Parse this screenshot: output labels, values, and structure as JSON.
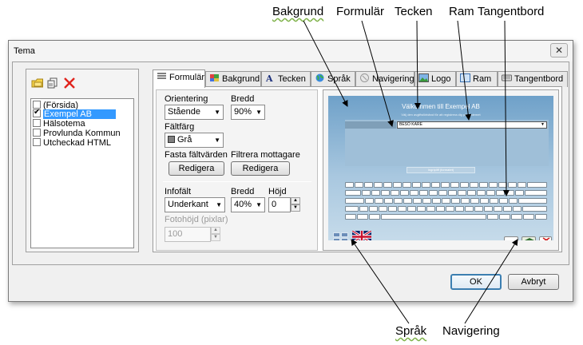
{
  "callouts": {
    "bakgrund": "Bakgrund",
    "formular": "Formulär",
    "tecken": "Tecken",
    "ram": "Ram",
    "tangentbord": "Tangentbord",
    "sprak": "Språk",
    "navigering": "Navigering"
  },
  "window": {
    "title": "Tema",
    "close": "✕"
  },
  "toolbar": {
    "icons": [
      "folder-icon",
      "copy-icon",
      "delete-icon"
    ]
  },
  "list": {
    "items": [
      {
        "label": "(Försida)",
        "checked": false,
        "selected": false
      },
      {
        "label": "Exempel AB",
        "checked": true,
        "selected": true
      },
      {
        "label": "Hälsotema",
        "checked": false,
        "selected": false
      },
      {
        "label": "Provlunda Kommun",
        "checked": false,
        "selected": false
      },
      {
        "label": "Utcheckad HTML",
        "checked": false,
        "selected": false
      }
    ]
  },
  "tabs": [
    {
      "label": "Formulär",
      "icon": "form-icon",
      "active": true
    },
    {
      "label": "Bakgrund",
      "icon": "background-icon"
    },
    {
      "label": "Tecken",
      "icon": "font-icon"
    },
    {
      "label": "Språk",
      "icon": "globe-icon"
    },
    {
      "label": "Navigering",
      "icon": "navigation-icon"
    },
    {
      "label": "Logo",
      "icon": "logo-icon"
    },
    {
      "label": "Ram",
      "icon": "frame-icon"
    },
    {
      "label": "Tangentbord",
      "icon": "keyboard-icon"
    }
  ],
  "form": {
    "orientering_label": "Orientering",
    "orientering_value": "Stående",
    "bredd_label": "Bredd",
    "bredd_value": "90%",
    "faltfarg_label": "Fältfärg",
    "faltfarg_value": "Grå",
    "faltfarg_swatch": "#808080",
    "fasta_label": "Fasta fältvärden",
    "filtrera_label": "Filtrera mottagare",
    "redigera": "Redigera",
    "infofalt_label": "Infofält",
    "infofalt_value": "Underkant",
    "info_bredd_label": "Bredd",
    "info_bredd_value": "40%",
    "hojd_label": "Höjd",
    "hojd_value": "0",
    "fotohojd_label": "Fotohöjd (pixlar)",
    "fotohojd_value": "100"
  },
  "preview": {
    "title": "Välkommen till Exempel AB",
    "subtitle": "Välj den avgiftsförbänd för att registrera dig på systemet",
    "select_value": "BESÖ KARE",
    "submit_text": "Ingripliff (formatet)",
    "colors": {
      "bg_top": "#6fa1c9",
      "form": "#9fbfd8"
    }
  },
  "buttons": {
    "ok": "OK",
    "cancel": "Avbryt"
  }
}
